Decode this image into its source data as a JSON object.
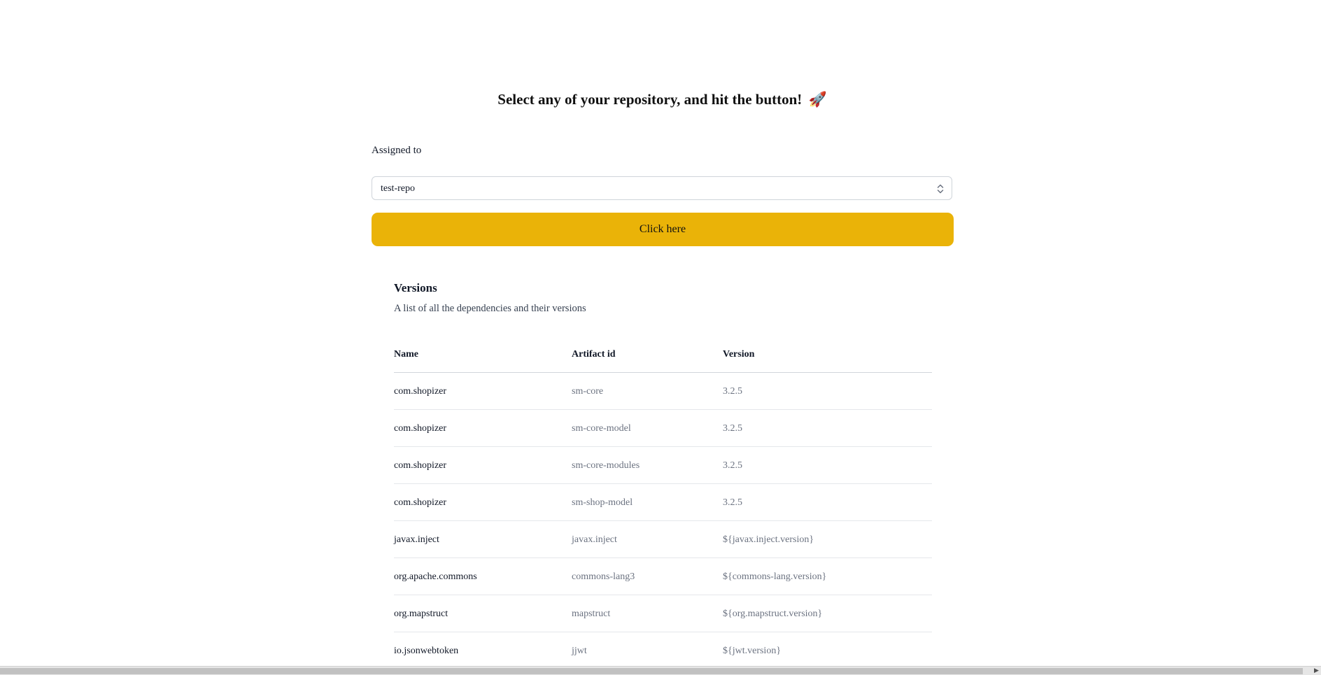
{
  "header": {
    "headline": "Select any of your repository, and hit the button!",
    "headline_emoji": "🚀"
  },
  "form": {
    "label": "Assigned to",
    "selected_repository": "test-repo",
    "chevron_icon": "chevron-up-down-icon",
    "submit_label": "Click here",
    "accent_color": "#eab308"
  },
  "versions": {
    "title": "Versions",
    "subtitle": "A list of all the dependencies and their versions",
    "columns": [
      "Name",
      "Artifact id",
      "Version"
    ],
    "rows": [
      [
        "com.shopizer",
        "sm-core",
        "3.2.5"
      ],
      [
        "com.shopizer",
        "sm-core-model",
        "3.2.5"
      ],
      [
        "com.shopizer",
        "sm-core-modules",
        "3.2.5"
      ],
      [
        "com.shopizer",
        "sm-shop-model",
        "3.2.5"
      ],
      [
        "javax.inject",
        "javax.inject",
        "${javax.inject.version}"
      ],
      [
        "org.apache.commons",
        "commons-lang3",
        "${commons-lang.version}"
      ],
      [
        "org.mapstruct",
        "mapstruct",
        "${org.mapstruct.version}"
      ],
      [
        "io.jsonwebtoken",
        "jjwt",
        "${jwt.version}"
      ]
    ]
  },
  "scrollbar": {
    "arrow_icon": "scroll-right-arrow-icon",
    "arrow_glyph": "▶"
  }
}
